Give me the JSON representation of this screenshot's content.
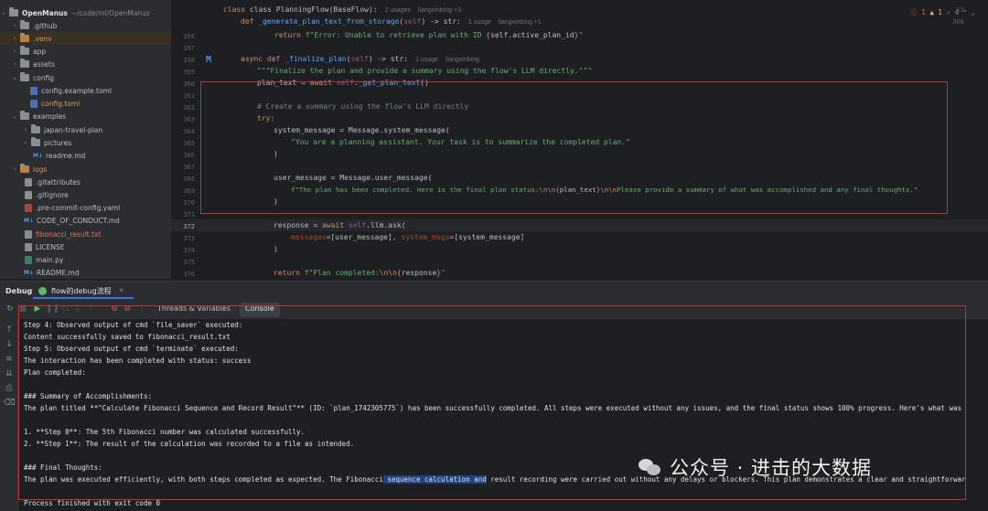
{
  "project_tree": {
    "root": {
      "name": "OpenManus",
      "path": "~/code/ml/OpenManus"
    },
    "items": [
      {
        "label": "OpenManus",
        "kind": "root"
      },
      {
        "label": ".github",
        "kind": "folder"
      },
      {
        "label": ".venv",
        "kind": "folder",
        "color": "orange"
      },
      {
        "label": "app",
        "kind": "folder"
      },
      {
        "label": "assets",
        "kind": "folder"
      },
      {
        "label": "config",
        "kind": "folder-open"
      },
      {
        "label": "config.example.toml",
        "kind": "toml"
      },
      {
        "label": "config.toml",
        "kind": "toml",
        "color": "orange"
      },
      {
        "label": "examples",
        "kind": "folder-open"
      },
      {
        "label": "japan-travel-plan",
        "kind": "folder"
      },
      {
        "label": "pictures",
        "kind": "folder"
      },
      {
        "label": "readme.md",
        "kind": "md"
      },
      {
        "label": "logs",
        "kind": "folder",
        "color": "orange"
      },
      {
        "label": ".gitattributes",
        "kind": "git"
      },
      {
        "label": ".gitignore",
        "kind": "git"
      },
      {
        "label": ".pre-commit-config.yaml",
        "kind": "yaml"
      },
      {
        "label": "CODE_OF_CONDUCT.md",
        "kind": "md"
      },
      {
        "label": "fibonacci_result.txt",
        "kind": "txt",
        "color": "red"
      },
      {
        "label": "LICENSE",
        "kind": "txt"
      },
      {
        "label": "main.py",
        "kind": "py"
      },
      {
        "label": "README.md",
        "kind": "md"
      }
    ],
    "md_badge": "M↓"
  },
  "editor": {
    "breadcrumb_line": "15",
    "breadcrumb_class": "class PlanningFlow(BaseFlow):",
    "breadcrumb_usages": "2 usages",
    "breadcrumb_author": "liangxinbing +3",
    "sticky_line": "306",
    "sticky_def": "def _generate_plan_text_from_storage(self) -> str:",
    "sticky_usage": "1 usage",
    "sticky_author": "liangxinbing +1",
    "errors": {
      "error_count": "1",
      "warning_count": "1",
      "check_count": "4"
    },
    "lines": [
      {
        "no": "356",
        "code": "return f\"Error: Unable to retrieve plan with ID {self.active_plan_id}\""
      },
      {
        "no": "357",
        "code": ""
      },
      {
        "no": "358",
        "code": "async def _finalize_plan(self) -> str:",
        "usage": "1 usage",
        "author": "liangxinbing"
      },
      {
        "no": "359",
        "code": "\"\"\"Finalize the plan and provide a summary using the flow's LLM directly.\"\"\""
      },
      {
        "no": "360",
        "code": "plan_text = await self._get_plan_text()"
      },
      {
        "no": "361",
        "code": ""
      },
      {
        "no": "362",
        "code": "# Create a summary using the flow's LLM directly"
      },
      {
        "no": "363",
        "code": "try:"
      },
      {
        "no": "364",
        "code": "system_message = Message.system_message("
      },
      {
        "no": "365",
        "code": "\"You are a planning assistant. Your task is to summarize the completed plan.\""
      },
      {
        "no": "366",
        "code": ")"
      },
      {
        "no": "367",
        "code": ""
      },
      {
        "no": "368",
        "code": "user_message = Message.user_message("
      },
      {
        "no": "369",
        "code": "f\"The plan has been completed. Here is the final plan status:\\n\\n{plan_text}\\n\\nPlease provide a summary of what was accomplished and any final thoughts.\""
      },
      {
        "no": "370",
        "code": ")"
      },
      {
        "no": "371",
        "code": ""
      },
      {
        "no": "372",
        "code": "response = await self.llm.ask("
      },
      {
        "no": "373",
        "code": "messages=[user_message], system_msgs=[system_message]"
      },
      {
        "no": "374",
        "code": ")"
      },
      {
        "no": "375",
        "code": ""
      },
      {
        "no": "376",
        "code": "return f\"Plan completed:\\n\\n{response}\""
      }
    ],
    "current_line": "372"
  },
  "debug": {
    "panel_title": "Debug",
    "session_tab": "flow的debug流程",
    "tabs": {
      "threads": "Threads & Variables",
      "console": "Console"
    }
  },
  "console": {
    "lines": [
      "Step 4: Observed output of cmd `file_saver` executed:",
      "Content successfully saved to fibonacci_result.txt",
      "Step 5: Observed output of cmd `terminate` executed:",
      "The interaction has been completed with status: success",
      "Plan completed:",
      "",
      "### Summary of Accomplishments:",
      "The plan titled **\"Calculate Fibonacci Sequence and Record Result\"** (ID: `plan_1742305775`) has been successfully completed. All steps were executed without any issues, and the final status shows 100% progress. Here's what was",
      "",
      "1. **Step 0**: The 5th Fibonacci number was calculated successfully.",
      "2. **Step 1**: The result of the calculation was recorded to a file as intended.",
      "",
      "### Final Thoughts:",
      "The plan was executed efficiently, with both steps completed as expected. The Fibonacci sequence calculation and result recording were carried out without any delays or blockers. This plan demonstrates a clear and straightforwar",
      "",
      "Process finished with exit code 0"
    ],
    "final_line_parts": {
      "before": "The plan was executed efficiently, with both steps completed as expected. The Fibonacci",
      "selected": " sequence calculation and",
      "after": " result recording were carried out without any delays or blockers. This plan demonstrates a clear and straightforwar"
    }
  },
  "watermark": {
    "text": "公众号 · 进击的大数据"
  },
  "colors": {
    "highlight_box": "#c4332f",
    "selection": "#214283"
  }
}
